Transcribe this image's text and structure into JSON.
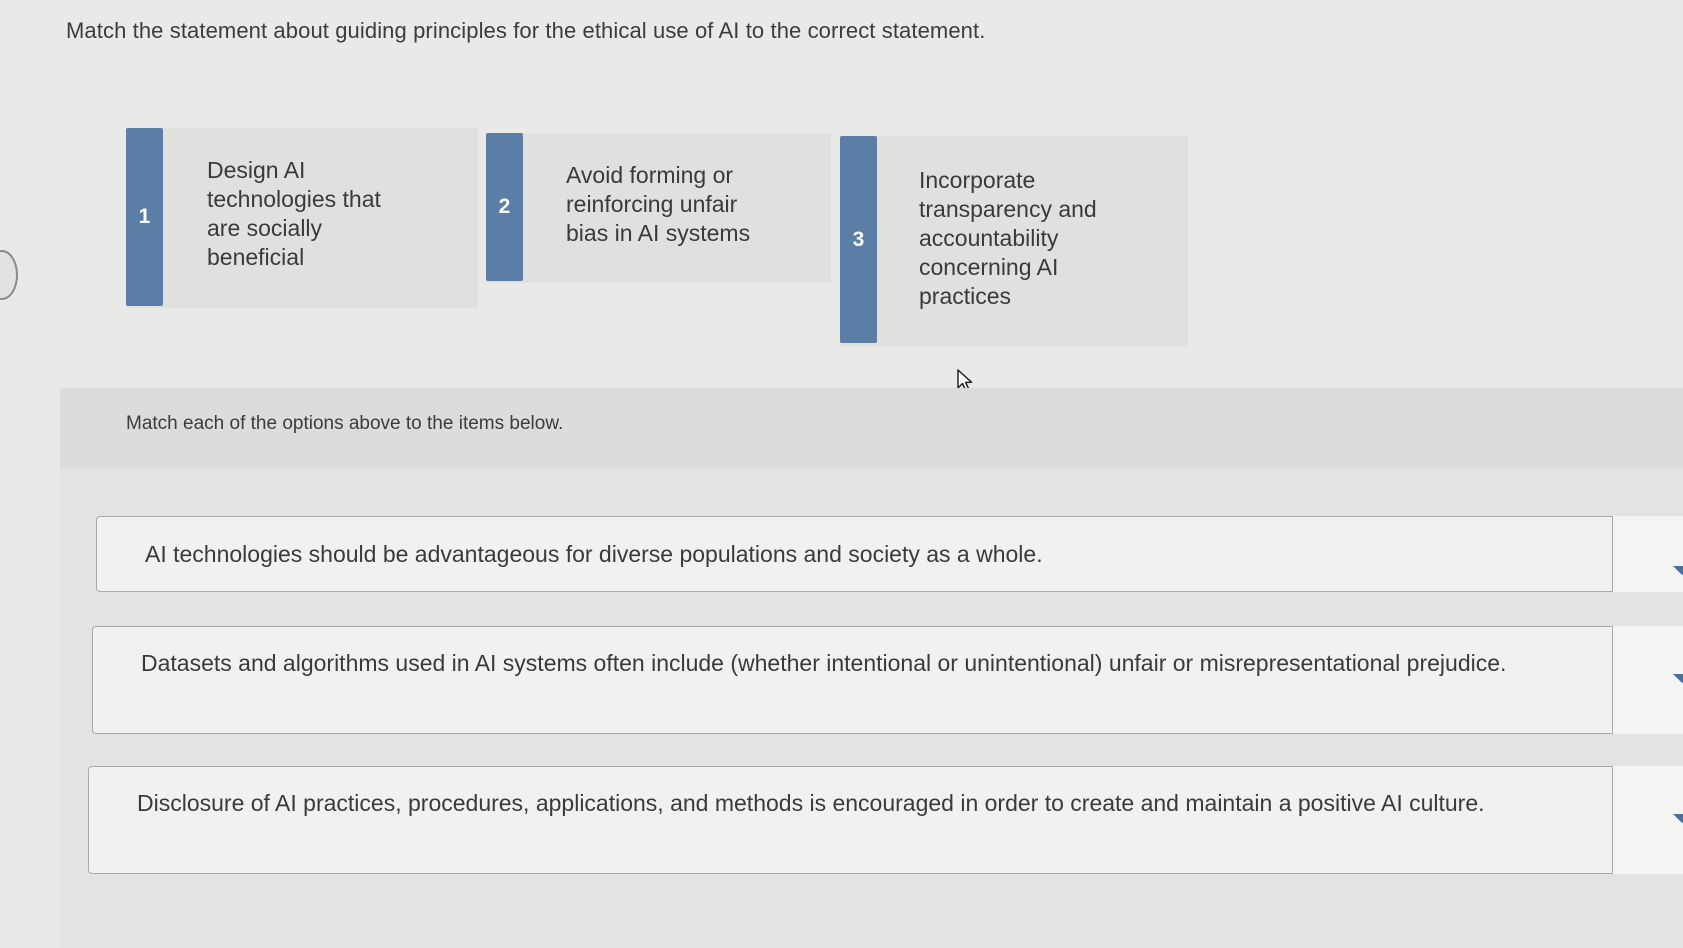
{
  "question": "Match the statement about guiding principles for the ethical use of AI to the correct statement.",
  "options": [
    {
      "number": "1",
      "text": "Design AI technologies that are socially beneficial"
    },
    {
      "number": "2",
      "text": "Avoid forming or reinforcing unfair bias in AI systems"
    },
    {
      "number": "3",
      "text": "Incorporate transparency and accountability concerning AI practices"
    }
  ],
  "instruction": "Match each of the options above to the items below.",
  "items": [
    {
      "text": "AI technologies should be advantageous for diverse populations and society as a whole."
    },
    {
      "text": "Datasets and algorithms used in AI systems often include (whether intentional or unintentional) unfair or misrepresentational prejudice."
    },
    {
      "text": "Disclosure of AI practices, procedures, applications, and methods is encouraged in order to create and maintain a positive AI culture."
    }
  ],
  "colors": {
    "number_badge": "#5b7ea7",
    "dropdown_arrow": "#4d6f98",
    "background": "#e9e9e8"
  },
  "icons": [
    "cursor-arrow-icon",
    "chevron-down-icon"
  ]
}
